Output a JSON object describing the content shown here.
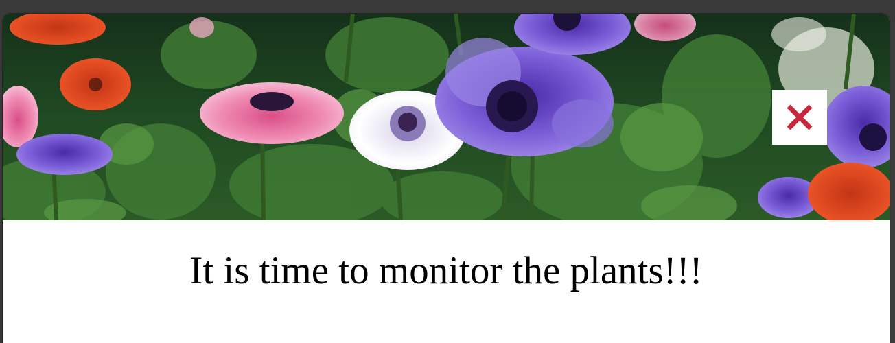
{
  "modal": {
    "banner_image": "anemone-flower-field",
    "close_button_icon": "close-x-icon",
    "close_color": "#c8283c",
    "message": "It is time to monitor the plants!!!"
  }
}
